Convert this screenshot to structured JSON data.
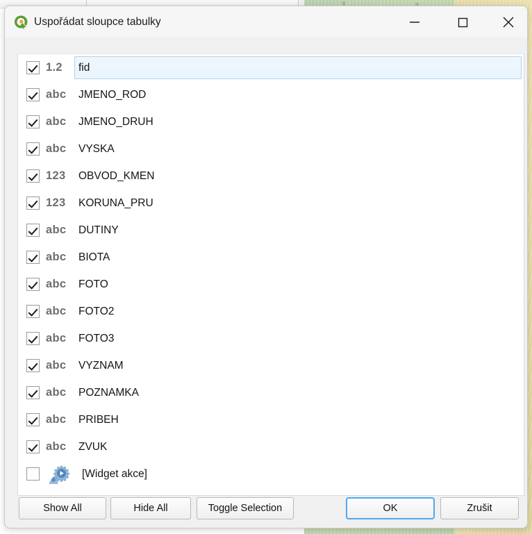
{
  "window": {
    "title": "Uspořádat sloupce tabulky",
    "app_icon": "qgis-logo-icon",
    "controls": {
      "minimize": "minimize-icon",
      "maximize": "maximize-icon",
      "close": "close-icon"
    }
  },
  "colors": {
    "accent_focus": "#4ea8ef",
    "selection_fill": "#eaf4fc",
    "selection_border": "#aed2ef",
    "type_icon": "#6e6e6e",
    "qgis_green": "#5a9e33",
    "qgis_orange": "#f29020",
    "widget_blue": "#5b8fc7"
  },
  "field_list": {
    "items": [
      {
        "checked": true,
        "type": "1.2",
        "label": "fid",
        "selected": true
      },
      {
        "checked": true,
        "type": "abc",
        "label": "JMENO_ROD",
        "selected": false
      },
      {
        "checked": true,
        "type": "abc",
        "label": "JMENO_DRUH",
        "selected": false
      },
      {
        "checked": true,
        "type": "abc",
        "label": "VYSKA",
        "selected": false
      },
      {
        "checked": true,
        "type": "123",
        "label": "OBVOD_KMEN",
        "selected": false
      },
      {
        "checked": true,
        "type": "123",
        "label": "KORUNA_PRU",
        "selected": false
      },
      {
        "checked": true,
        "type": "abc",
        "label": "DUTINY",
        "selected": false
      },
      {
        "checked": true,
        "type": "abc",
        "label": "BIOTA",
        "selected": false
      },
      {
        "checked": true,
        "type": "abc",
        "label": "FOTO",
        "selected": false
      },
      {
        "checked": true,
        "type": "abc",
        "label": "FOTO2",
        "selected": false
      },
      {
        "checked": true,
        "type": "abc",
        "label": "FOTO3",
        "selected": false
      },
      {
        "checked": true,
        "type": "abc",
        "label": "VYZNAM",
        "selected": false
      },
      {
        "checked": true,
        "type": "abc",
        "label": "POZNAMKA",
        "selected": false
      },
      {
        "checked": true,
        "type": "abc",
        "label": "PRIBEH",
        "selected": false
      },
      {
        "checked": true,
        "type": "abc",
        "label": "ZVUK",
        "selected": false
      },
      {
        "checked": false,
        "type": "widget",
        "label": "[Widget akce]",
        "selected": false
      }
    ]
  },
  "buttons": {
    "show_all": "Show All",
    "hide_all": "Hide All",
    "toggle_selection": "Toggle Selection",
    "ok": "OK",
    "cancel": "Zrušit"
  }
}
